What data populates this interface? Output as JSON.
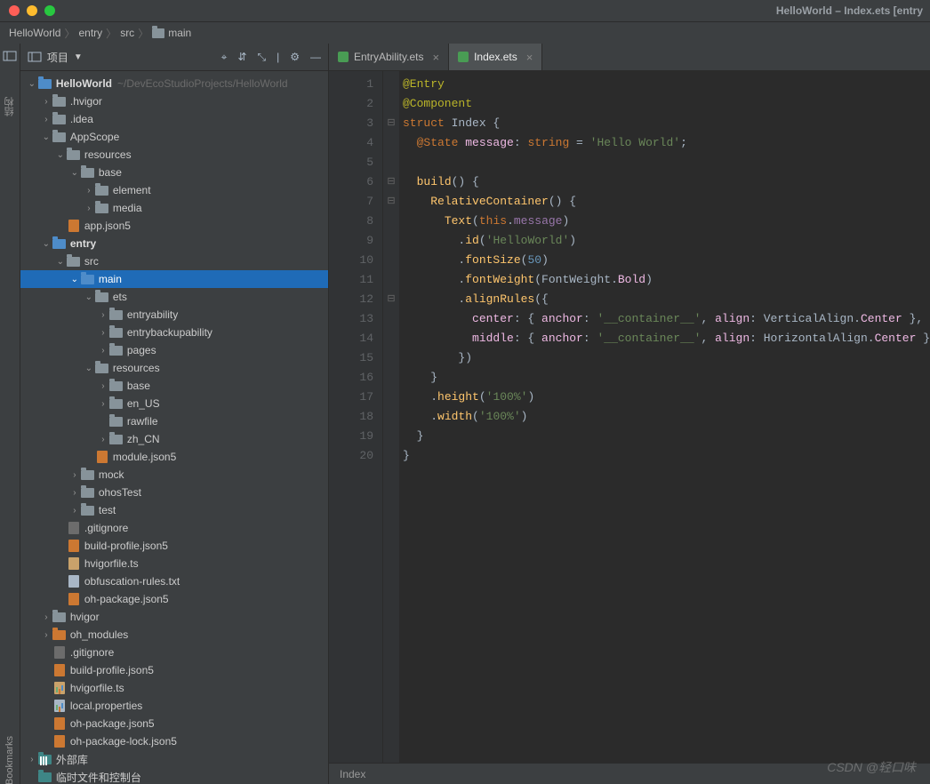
{
  "window": {
    "title": "HelloWorld – Index.ets [entry"
  },
  "breadcrumb": [
    "HelloWorld",
    "entry",
    "src",
    "main"
  ],
  "sidebar": {
    "title": "项目",
    "tree": [
      {
        "d": 0,
        "a": "v",
        "ic": "fld blue",
        "lbl": "HelloWorld",
        "bold": true,
        "muted": "~/DevEcoStudioProjects/HelloWorld"
      },
      {
        "d": 1,
        "a": ">",
        "ic": "fld",
        "lbl": ".hvigor"
      },
      {
        "d": 1,
        "a": ">",
        "ic": "fld",
        "lbl": ".idea"
      },
      {
        "d": 1,
        "a": "v",
        "ic": "fld",
        "lbl": "AppScope"
      },
      {
        "d": 2,
        "a": "v",
        "ic": "fld",
        "lbl": "resources"
      },
      {
        "d": 3,
        "a": "v",
        "ic": "fld",
        "lbl": "base"
      },
      {
        "d": 4,
        "a": ">",
        "ic": "fld",
        "lbl": "element"
      },
      {
        "d": 4,
        "a": ">",
        "ic": "fld",
        "lbl": "media"
      },
      {
        "d": 2,
        "a": "",
        "ic": "fil json",
        "lbl": "app.json5"
      },
      {
        "d": 1,
        "a": "v",
        "ic": "fld blue",
        "lbl": "entry",
        "bold": true
      },
      {
        "d": 2,
        "a": "v",
        "ic": "fld",
        "lbl": "src"
      },
      {
        "d": 3,
        "a": "v",
        "ic": "fld blue",
        "lbl": "main",
        "sel": true
      },
      {
        "d": 4,
        "a": "v",
        "ic": "fld",
        "lbl": "ets"
      },
      {
        "d": 5,
        "a": ">",
        "ic": "fld",
        "lbl": "entryability"
      },
      {
        "d": 5,
        "a": ">",
        "ic": "fld",
        "lbl": "entrybackupability"
      },
      {
        "d": 5,
        "a": ">",
        "ic": "fld",
        "lbl": "pages"
      },
      {
        "d": 4,
        "a": "v",
        "ic": "fld",
        "lbl": "resources"
      },
      {
        "d": 5,
        "a": ">",
        "ic": "fld",
        "lbl": "base"
      },
      {
        "d": 5,
        "a": ">",
        "ic": "fld",
        "lbl": "en_US"
      },
      {
        "d": 5,
        "a": "",
        "ic": "fld",
        "lbl": "rawfile"
      },
      {
        "d": 5,
        "a": ">",
        "ic": "fld",
        "lbl": "zh_CN"
      },
      {
        "d": 4,
        "a": "",
        "ic": "fil json",
        "lbl": "module.json5"
      },
      {
        "d": 3,
        "a": ">",
        "ic": "fld",
        "lbl": "mock"
      },
      {
        "d": 3,
        "a": ">",
        "ic": "fld",
        "lbl": "ohosTest"
      },
      {
        "d": 3,
        "a": ">",
        "ic": "fld",
        "lbl": "test"
      },
      {
        "d": 2,
        "a": "",
        "ic": "fil git",
        "lbl": ".gitignore"
      },
      {
        "d": 2,
        "a": "",
        "ic": "fil json",
        "lbl": "build-profile.json5"
      },
      {
        "d": 2,
        "a": "",
        "ic": "fil js",
        "lbl": "hvigorfile.ts"
      },
      {
        "d": 2,
        "a": "",
        "ic": "fil",
        "lbl": "obfuscation-rules.txt"
      },
      {
        "d": 2,
        "a": "",
        "ic": "fil json",
        "lbl": "oh-package.json5"
      },
      {
        "d": 1,
        "a": ">",
        "ic": "fld",
        "lbl": "hvigor"
      },
      {
        "d": 1,
        "a": ">",
        "ic": "fld orange",
        "lbl": "oh_modules"
      },
      {
        "d": 1,
        "a": "",
        "ic": "fil git",
        "lbl": ".gitignore"
      },
      {
        "d": 1,
        "a": "",
        "ic": "fil json",
        "lbl": "build-profile.json5"
      },
      {
        "d": 1,
        "a": "",
        "ic": "fil js bars",
        "lbl": "hvigorfile.ts"
      },
      {
        "d": 1,
        "a": "",
        "ic": "fil bars",
        "lbl": "local.properties"
      },
      {
        "d": 1,
        "a": "",
        "ic": "fil json",
        "lbl": "oh-package.json5"
      },
      {
        "d": 1,
        "a": "",
        "ic": "fil json",
        "lbl": "oh-package-lock.json5"
      },
      {
        "d": 0,
        "a": ">",
        "ic": "fld teal lib",
        "lbl": "外部库"
      },
      {
        "d": 0,
        "a": "",
        "ic": "fld teal",
        "lbl": "临时文件和控制台"
      }
    ]
  },
  "vlabels": {
    "top": "结构",
    "bottom": "Bookmarks"
  },
  "tabs": [
    {
      "label": "EntryAbility.ets",
      "active": false
    },
    {
      "label": "Index.ets",
      "active": true
    }
  ],
  "lineNumbers": [
    "1",
    "2",
    "3",
    "4",
    "5",
    "6",
    "7",
    "8",
    "9",
    "10",
    "11",
    "12",
    "13",
    "14",
    "15",
    "16",
    "17",
    "18",
    "19",
    "20"
  ],
  "fold": [
    "",
    "",
    "⊟",
    "",
    "",
    "⊟",
    "⊟",
    "",
    "",
    "",
    "",
    "⊟",
    "",
    "",
    "",
    "",
    "",
    "",
    "",
    ""
  ],
  "code": [
    [
      {
        "t": "@Entry",
        "c": "k-ann"
      }
    ],
    [
      {
        "t": "@Component",
        "c": "k-ann"
      }
    ],
    [
      {
        "t": "struct ",
        "c": "k-kw"
      },
      {
        "t": "Index ",
        "c": "k-cl"
      },
      {
        "t": "{",
        "c": "k-op"
      }
    ],
    [
      {
        "t": "  @State ",
        "c": "k-kw"
      },
      {
        "t": "message",
        "c": "k-id"
      },
      {
        "t": ": ",
        "c": "k-op"
      },
      {
        "t": "string ",
        "c": "k-kw"
      },
      {
        "t": "= ",
        "c": "k-op"
      },
      {
        "t": "'Hello World'",
        "c": "k-str"
      },
      {
        "t": ";",
        "c": "k-op"
      }
    ],
    [],
    [
      {
        "t": "  ",
        "c": ""
      },
      {
        "t": "build",
        "c": "k-fn"
      },
      {
        "t": "() {",
        "c": "k-op"
      }
    ],
    [
      {
        "t": "    ",
        "c": ""
      },
      {
        "t": "RelativeContainer",
        "c": "k-fn"
      },
      {
        "t": "() {",
        "c": "k-op"
      }
    ],
    [
      {
        "t": "      ",
        "c": ""
      },
      {
        "t": "Text",
        "c": "k-fn"
      },
      {
        "t": "(",
        "c": "k-op"
      },
      {
        "t": "this",
        "c": "k-this"
      },
      {
        "t": ".",
        "c": "k-op"
      },
      {
        "t": "message",
        "c": "k-prop"
      },
      {
        "t": ")",
        "c": "k-op"
      }
    ],
    [
      {
        "t": "        .",
        "c": "k-op"
      },
      {
        "t": "id",
        "c": "k-fn"
      },
      {
        "t": "(",
        "c": "k-op"
      },
      {
        "t": "'HelloWorld'",
        "c": "k-str"
      },
      {
        "t": ")",
        "c": "k-op"
      }
    ],
    [
      {
        "t": "        .",
        "c": "k-op"
      },
      {
        "t": "fontSize",
        "c": "k-fn"
      },
      {
        "t": "(",
        "c": "k-op"
      },
      {
        "t": "50",
        "c": "k-num"
      },
      {
        "t": ")",
        "c": "k-op"
      }
    ],
    [
      {
        "t": "        .",
        "c": "k-op"
      },
      {
        "t": "fontWeight",
        "c": "k-fn"
      },
      {
        "t": "(",
        "c": "k-op"
      },
      {
        "t": "FontWeight",
        "c": "k-def"
      },
      {
        "t": ".",
        "c": "k-op"
      },
      {
        "t": "Bold",
        "c": "k-id"
      },
      {
        "t": ")",
        "c": "k-op"
      }
    ],
    [
      {
        "t": "        .",
        "c": "k-op"
      },
      {
        "t": "alignRules",
        "c": "k-fn"
      },
      {
        "t": "({",
        "c": "k-op"
      }
    ],
    [
      {
        "t": "          ",
        "c": ""
      },
      {
        "t": "center",
        "c": "k-id"
      },
      {
        "t": ": { ",
        "c": "k-op"
      },
      {
        "t": "anchor",
        "c": "k-id"
      },
      {
        "t": ": ",
        "c": "k-op"
      },
      {
        "t": "'__container__'",
        "c": "k-str"
      },
      {
        "t": ", ",
        "c": "k-op"
      },
      {
        "t": "align",
        "c": "k-id"
      },
      {
        "t": ": ",
        "c": "k-op"
      },
      {
        "t": "VerticalAlign",
        "c": "k-def"
      },
      {
        "t": ".",
        "c": "k-op"
      },
      {
        "t": "Center ",
        "c": "k-id"
      },
      {
        "t": "},",
        "c": "k-op"
      }
    ],
    [
      {
        "t": "          ",
        "c": ""
      },
      {
        "t": "middle",
        "c": "k-id"
      },
      {
        "t": ": { ",
        "c": "k-op"
      },
      {
        "t": "anchor",
        "c": "k-id"
      },
      {
        "t": ": ",
        "c": "k-op"
      },
      {
        "t": "'__container__'",
        "c": "k-str"
      },
      {
        "t": ", ",
        "c": "k-op"
      },
      {
        "t": "align",
        "c": "k-id"
      },
      {
        "t": ": ",
        "c": "k-op"
      },
      {
        "t": "HorizontalAlign",
        "c": "k-def"
      },
      {
        "t": ".",
        "c": "k-op"
      },
      {
        "t": "Center ",
        "c": "k-id"
      },
      {
        "t": "}",
        "c": "k-op"
      }
    ],
    [
      {
        "t": "        })",
        "c": "k-op"
      }
    ],
    [
      {
        "t": "    }",
        "c": "k-op"
      }
    ],
    [
      {
        "t": "    .",
        "c": "k-op"
      },
      {
        "t": "height",
        "c": "k-fn"
      },
      {
        "t": "(",
        "c": "k-op"
      },
      {
        "t": "'100%'",
        "c": "k-str"
      },
      {
        "t": ")",
        "c": "k-op"
      }
    ],
    [
      {
        "t": "    .",
        "c": "k-op"
      },
      {
        "t": "width",
        "c": "k-fn"
      },
      {
        "t": "(",
        "c": "k-op"
      },
      {
        "t": "'100%'",
        "c": "k-str"
      },
      {
        "t": ")",
        "c": "k-op"
      }
    ],
    [
      {
        "t": "  }",
        "c": "k-op"
      }
    ],
    [
      {
        "t": "}",
        "c": "k-op"
      }
    ]
  ],
  "crumb": "Index",
  "watermark": "CSDN @轻口味"
}
